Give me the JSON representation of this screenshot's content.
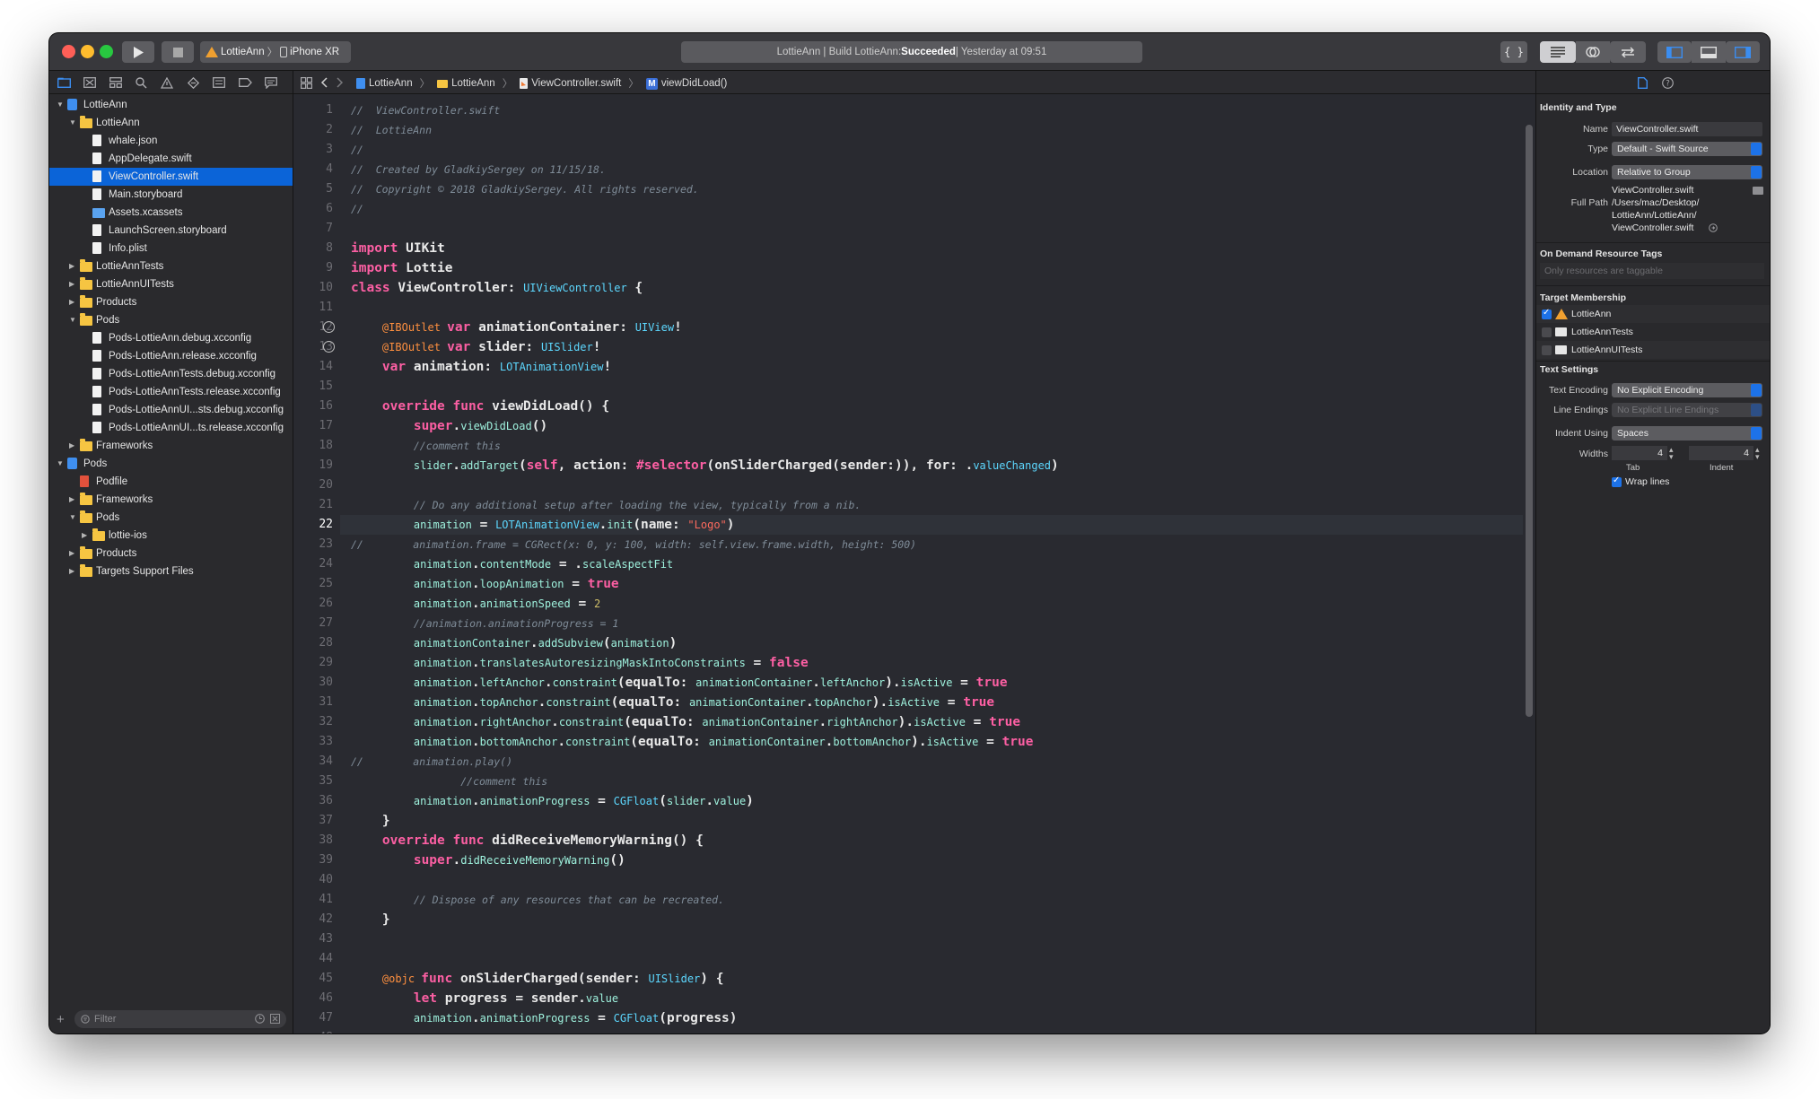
{
  "toolbar": {
    "scheme_target": "LottieAnn",
    "scheme_device": "iPhone XR",
    "status_prefix": "LottieAnn | Build LottieAnn: ",
    "status_result": "Succeeded",
    "status_suffix": " | Yesterday at 09:51",
    "right_braces": "{ }"
  },
  "navigator": {
    "filter_placeholder": "Filter",
    "items": [
      {
        "label": "LottieAnn",
        "depth": 0,
        "icon": "project",
        "expanded": true
      },
      {
        "label": "LottieAnn",
        "depth": 1,
        "icon": "folder",
        "expanded": true
      },
      {
        "label": "whale.json",
        "depth": 2,
        "icon": "doc"
      },
      {
        "label": "AppDelegate.swift",
        "depth": 2,
        "icon": "doc"
      },
      {
        "label": "ViewController.swift",
        "depth": 2,
        "icon": "doc",
        "selected": true
      },
      {
        "label": "Main.storyboard",
        "depth": 2,
        "icon": "doc"
      },
      {
        "label": "Assets.xcassets",
        "depth": 2,
        "icon": "bluefolder"
      },
      {
        "label": "LaunchScreen.storyboard",
        "depth": 2,
        "icon": "doc"
      },
      {
        "label": "Info.plist",
        "depth": 2,
        "icon": "doc"
      },
      {
        "label": "LottieAnnTests",
        "depth": 1,
        "icon": "folder",
        "expanded": false
      },
      {
        "label": "LottieAnnUITests",
        "depth": 1,
        "icon": "folder",
        "expanded": false
      },
      {
        "label": "Products",
        "depth": 1,
        "icon": "folder",
        "expanded": false
      },
      {
        "label": "Pods",
        "depth": 1,
        "icon": "folder",
        "expanded": true
      },
      {
        "label": "Pods-LottieAnn.debug.xcconfig",
        "depth": 2,
        "icon": "doc"
      },
      {
        "label": "Pods-LottieAnn.release.xcconfig",
        "depth": 2,
        "icon": "doc"
      },
      {
        "label": "Pods-LottieAnnTests.debug.xcconfig",
        "depth": 2,
        "icon": "doc"
      },
      {
        "label": "Pods-LottieAnnTests.release.xcconfig",
        "depth": 2,
        "icon": "doc"
      },
      {
        "label": "Pods-LottieAnnUI...sts.debug.xcconfig",
        "depth": 2,
        "icon": "doc"
      },
      {
        "label": "Pods-LottieAnnUI...ts.release.xcconfig",
        "depth": 2,
        "icon": "doc"
      },
      {
        "label": "Frameworks",
        "depth": 1,
        "icon": "folder",
        "expanded": false
      },
      {
        "label": "Pods",
        "depth": 0,
        "icon": "project",
        "expanded": true
      },
      {
        "label": "Podfile",
        "depth": 1,
        "icon": "reddoc"
      },
      {
        "label": "Frameworks",
        "depth": 1,
        "icon": "folder",
        "expanded": false
      },
      {
        "label": "Pods",
        "depth": 1,
        "icon": "folder",
        "expanded": true
      },
      {
        "label": "lottie-ios",
        "depth": 2,
        "icon": "folder",
        "expanded": false
      },
      {
        "label": "Products",
        "depth": 1,
        "icon": "folder",
        "expanded": false
      },
      {
        "label": "Targets Support Files",
        "depth": 1,
        "icon": "folder",
        "expanded": false
      }
    ]
  },
  "jumpbar": {
    "crumbs": [
      "LottieAnn",
      "LottieAnn",
      "ViewController.swift",
      "viewDidLoad()"
    ],
    "method_badge": "M"
  },
  "editor": {
    "current_line": 22,
    "lines": [
      [
        [
          "cm",
          "//  ViewController.swift"
        ]
      ],
      [
        [
          "cm",
          "//  LottieAnn"
        ]
      ],
      [
        [
          "cm",
          "//"
        ]
      ],
      [
        [
          "cm",
          "//  Created by GladkiySergey on 11/15/18."
        ]
      ],
      [
        [
          "cm",
          "//  Copyright © 2018 GladkiySergey. All rights reserved."
        ]
      ],
      [
        [
          "cm",
          "//"
        ]
      ],
      [],
      [
        [
          "kw",
          "import "
        ],
        [
          "pl",
          "UIKit"
        ]
      ],
      [
        [
          "kw",
          "import "
        ],
        [
          "pl",
          "Lottie"
        ]
      ],
      [
        [
          "kw",
          "class "
        ],
        [
          "pl",
          "ViewController"
        ],
        [
          "pl",
          ": "
        ],
        [
          "ty",
          "UIViewController"
        ],
        [
          "pl",
          " {"
        ]
      ],
      [],
      [
        [
          "pl",
          "    "
        ],
        [
          "at",
          "@IBOutlet "
        ],
        [
          "kw",
          "var "
        ],
        [
          "pl",
          "animationContainer"
        ],
        [
          "pl",
          ": "
        ],
        [
          "ty",
          "UIView"
        ],
        [
          "pl",
          "!"
        ]
      ],
      [
        [
          "pl",
          "    "
        ],
        [
          "at",
          "@IBOutlet "
        ],
        [
          "kw",
          "var "
        ],
        [
          "pl",
          "slider"
        ],
        [
          "pl",
          ": "
        ],
        [
          "ty",
          "UISlider"
        ],
        [
          "pl",
          "!"
        ]
      ],
      [
        [
          "pl",
          "    "
        ],
        [
          "kw",
          "var "
        ],
        [
          "pl",
          "animation"
        ],
        [
          "pl",
          ": "
        ],
        [
          "ty",
          "LOTAnimationView"
        ],
        [
          "pl",
          "!"
        ]
      ],
      [],
      [
        [
          "pl",
          "    "
        ],
        [
          "kw",
          "override func "
        ],
        [
          "pl",
          "viewDidLoad"
        ],
        [
          "pl",
          "() {"
        ]
      ],
      [
        [
          "pl",
          "        "
        ],
        [
          "kw",
          "super"
        ],
        [
          "pl",
          "."
        ],
        [
          "dt",
          "viewDidLoad"
        ],
        [
          "pl",
          "()"
        ]
      ],
      [
        [
          "pl",
          "        "
        ],
        [
          "cm",
          "//comment this"
        ]
      ],
      [
        [
          "pl",
          "        "
        ],
        [
          "dt",
          "slider"
        ],
        [
          "pl",
          "."
        ],
        [
          "dt",
          "addTarget"
        ],
        [
          "pl",
          "("
        ],
        [
          "kw",
          "self"
        ],
        [
          "pl",
          ", action: "
        ],
        [
          "kw",
          "#selector"
        ],
        [
          "pl",
          "(onSliderCharged(sender:)), for: ."
        ],
        [
          "ty",
          "valueChanged"
        ],
        [
          "pl",
          ")"
        ]
      ],
      [],
      [
        [
          "pl",
          "        "
        ],
        [
          "cm",
          "// Do any additional setup after loading the view, typically from a nib."
        ]
      ],
      [
        [
          "pl",
          "        "
        ],
        [
          "dt",
          "animation"
        ],
        [
          "pl",
          " = "
        ],
        [
          "ty",
          "LOTAnimationView"
        ],
        [
          "pl",
          "."
        ],
        [
          "dt",
          "init"
        ],
        [
          "pl",
          "(name: "
        ],
        [
          "st",
          "\"Logo\""
        ],
        [
          "pl",
          ")"
        ]
      ],
      [
        [
          "cm",
          "//        animation.frame = CGRect(x: 0, y: 100, width: self.view.frame.width, height: 500)"
        ]
      ],
      [
        [
          "pl",
          "        "
        ],
        [
          "dt",
          "animation"
        ],
        [
          "pl",
          "."
        ],
        [
          "dt",
          "contentMode"
        ],
        [
          "pl",
          " = ."
        ],
        [
          "dt",
          "scaleAspectFit"
        ]
      ],
      [
        [
          "pl",
          "        "
        ],
        [
          "dt",
          "animation"
        ],
        [
          "pl",
          "."
        ],
        [
          "dt",
          "loopAnimation"
        ],
        [
          "pl",
          " = "
        ],
        [
          "kw",
          "true"
        ]
      ],
      [
        [
          "pl",
          "        "
        ],
        [
          "dt",
          "animation"
        ],
        [
          "pl",
          "."
        ],
        [
          "dt",
          "animationSpeed"
        ],
        [
          "pl",
          " = "
        ],
        [
          "nm",
          "2"
        ]
      ],
      [
        [
          "pl",
          "        "
        ],
        [
          "cm",
          "//animation.animationProgress = 1"
        ]
      ],
      [
        [
          "pl",
          "        "
        ],
        [
          "dt",
          "animationContainer"
        ],
        [
          "pl",
          "."
        ],
        [
          "dt",
          "addSubview"
        ],
        [
          "pl",
          "("
        ],
        [
          "dt",
          "animation"
        ],
        [
          "pl",
          ")"
        ]
      ],
      [
        [
          "pl",
          "        "
        ],
        [
          "dt",
          "animation"
        ],
        [
          "pl",
          "."
        ],
        [
          "dt",
          "translatesAutoresizingMaskIntoConstraints"
        ],
        [
          "pl",
          " = "
        ],
        [
          "kw",
          "false"
        ]
      ],
      [
        [
          "pl",
          "        "
        ],
        [
          "dt",
          "animation"
        ],
        [
          "pl",
          "."
        ],
        [
          "dt",
          "leftAnchor"
        ],
        [
          "pl",
          "."
        ],
        [
          "dt",
          "constraint"
        ],
        [
          "pl",
          "(equalTo: "
        ],
        [
          "dt",
          "animationContainer"
        ],
        [
          "pl",
          "."
        ],
        [
          "dt",
          "leftAnchor"
        ],
        [
          "pl",
          ")."
        ],
        [
          "dt",
          "isActive"
        ],
        [
          "pl",
          " = "
        ],
        [
          "kw",
          "true"
        ]
      ],
      [
        [
          "pl",
          "        "
        ],
        [
          "dt",
          "animation"
        ],
        [
          "pl",
          "."
        ],
        [
          "dt",
          "topAnchor"
        ],
        [
          "pl",
          "."
        ],
        [
          "dt",
          "constraint"
        ],
        [
          "pl",
          "(equalTo: "
        ],
        [
          "dt",
          "animationContainer"
        ],
        [
          "pl",
          "."
        ],
        [
          "dt",
          "topAnchor"
        ],
        [
          "pl",
          ")."
        ],
        [
          "dt",
          "isActive"
        ],
        [
          "pl",
          " = "
        ],
        [
          "kw",
          "true"
        ]
      ],
      [
        [
          "pl",
          "        "
        ],
        [
          "dt",
          "animation"
        ],
        [
          "pl",
          "."
        ],
        [
          "dt",
          "rightAnchor"
        ],
        [
          "pl",
          "."
        ],
        [
          "dt",
          "constraint"
        ],
        [
          "pl",
          "(equalTo: "
        ],
        [
          "dt",
          "animationContainer"
        ],
        [
          "pl",
          "."
        ],
        [
          "dt",
          "rightAnchor"
        ],
        [
          "pl",
          ")."
        ],
        [
          "dt",
          "isActive"
        ],
        [
          "pl",
          " = "
        ],
        [
          "kw",
          "true"
        ]
      ],
      [
        [
          "pl",
          "        "
        ],
        [
          "dt",
          "animation"
        ],
        [
          "pl",
          "."
        ],
        [
          "dt",
          "bottomAnchor"
        ],
        [
          "pl",
          "."
        ],
        [
          "dt",
          "constraint"
        ],
        [
          "pl",
          "(equalTo: "
        ],
        [
          "dt",
          "animationContainer"
        ],
        [
          "pl",
          "."
        ],
        [
          "dt",
          "bottomAnchor"
        ],
        [
          "pl",
          ")."
        ],
        [
          "dt",
          "isActive"
        ],
        [
          "pl",
          " = "
        ],
        [
          "kw",
          "true"
        ]
      ],
      [
        [
          "cm",
          "//        animation.play()"
        ]
      ],
      [
        [
          "pl",
          "              "
        ],
        [
          "cm",
          "//comment this"
        ]
      ],
      [
        [
          "pl",
          "        "
        ],
        [
          "dt",
          "animation"
        ],
        [
          "pl",
          "."
        ],
        [
          "dt",
          "animationProgress"
        ],
        [
          "pl",
          " = "
        ],
        [
          "ty",
          "CGFloat"
        ],
        [
          "pl",
          "("
        ],
        [
          "dt",
          "slider"
        ],
        [
          "pl",
          "."
        ],
        [
          "dt",
          "value"
        ],
        [
          "pl",
          ")"
        ]
      ],
      [
        [
          "pl",
          "    }"
        ]
      ],
      [
        [
          "pl",
          "    "
        ],
        [
          "kw",
          "override func "
        ],
        [
          "pl",
          "didReceiveMemoryWarning"
        ],
        [
          "pl",
          "() {"
        ]
      ],
      [
        [
          "pl",
          "        "
        ],
        [
          "kw",
          "super"
        ],
        [
          "pl",
          "."
        ],
        [
          "dt",
          "didReceiveMemoryWarning"
        ],
        [
          "pl",
          "()"
        ]
      ],
      [],
      [
        [
          "pl",
          "        "
        ],
        [
          "cm",
          "// Dispose of any resources that can be recreated."
        ]
      ],
      [
        [
          "pl",
          "    }"
        ]
      ],
      [],
      [],
      [
        [
          "pl",
          "    "
        ],
        [
          "at",
          "@objc "
        ],
        [
          "kw",
          "func "
        ],
        [
          "pl",
          "onSliderCharged"
        ],
        [
          "pl",
          "(sender: "
        ],
        [
          "ty",
          "UISlider"
        ],
        [
          "pl",
          ") {"
        ]
      ],
      [
        [
          "pl",
          "        "
        ],
        [
          "kw",
          "let "
        ],
        [
          "pl",
          "progress"
        ],
        [
          "pl",
          " = sender."
        ],
        [
          "dt",
          "value"
        ]
      ],
      [
        [
          "pl",
          "        "
        ],
        [
          "dt",
          "animation"
        ],
        [
          "pl",
          "."
        ],
        [
          "dt",
          "animationProgress"
        ],
        [
          "pl",
          " = "
        ],
        [
          "ty",
          "CGFloat"
        ],
        [
          "pl",
          "(progress)"
        ]
      ],
      []
    ],
    "outlet_lines": [
      12,
      13
    ]
  },
  "inspector": {
    "identity_title": "Identity and Type",
    "name_label": "Name",
    "name_value": "ViewController.swift",
    "type_label": "Type",
    "type_value": "Default - Swift Source",
    "location_label": "Location",
    "location_value": "Relative to Group",
    "location_file": "ViewController.swift",
    "fullpath_label": "Full Path",
    "fullpath_1": "/Users/mac/Desktop/",
    "fullpath_2": "LottieAnn/LottieAnn/",
    "fullpath_3": "ViewController.swift",
    "odr_title": "On Demand Resource Tags",
    "odr_placeholder": "Only resources are taggable",
    "membership_title": "Target Membership",
    "targets": [
      {
        "name": "LottieAnn",
        "checked": true
      },
      {
        "name": "LottieAnnTests",
        "checked": false
      },
      {
        "name": "LottieAnnUITests",
        "checked": false
      }
    ],
    "text_title": "Text Settings",
    "encoding_label": "Text Encoding",
    "encoding_value": "No Explicit Encoding",
    "endings_label": "Line Endings",
    "endings_value": "No Explicit Line Endings",
    "indent_label": "Indent Using",
    "indent_value": "Spaces",
    "widths_label": "Widths",
    "tab_value": "4",
    "indent_width_value": "4",
    "tab_caption": "Tab",
    "indent_caption": "Indent",
    "wrap_label": "Wrap lines",
    "wrap_checked": true
  },
  "colors": {
    "selection": "#0b64d8",
    "keyword": "#fc5fa3",
    "type": "#5dd8ff",
    "string": "#fc6a5d",
    "comment": "#7f8c98",
    "accent": "#1d72e8"
  }
}
